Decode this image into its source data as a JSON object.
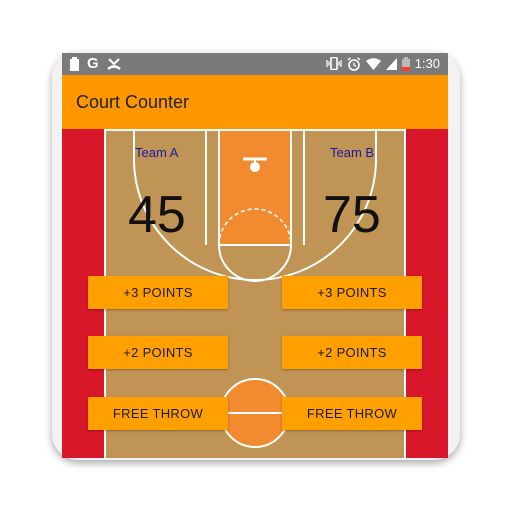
{
  "status_bar": {
    "icons_left": [
      "battery-icon",
      "google-icon",
      "missed-call-icon"
    ],
    "google_glyph": "G",
    "icons_right": [
      "vibrate-icon",
      "alarm-icon",
      "wifi-icon",
      "signal-icon",
      "battery-low-icon"
    ],
    "time": "1:30"
  },
  "app_bar": {
    "title": "Court Counter",
    "color": "#ff9800"
  },
  "team_a": {
    "name": "Team A",
    "score": "45",
    "buttons": {
      "three": "+3 POINTS",
      "two": "+2 POINTS",
      "free_throw": "FREE THROW"
    }
  },
  "team_b": {
    "name": "Team B",
    "score": "75",
    "buttons": {
      "three": "+3 POINTS",
      "two": "+2 POINTS",
      "free_throw": "FREE THROW"
    }
  },
  "colors": {
    "court": "#bf9454",
    "paint": "#f28a30",
    "side": "#d9172a",
    "button": "#ffa000",
    "team_label": "#1a1aa6"
  }
}
